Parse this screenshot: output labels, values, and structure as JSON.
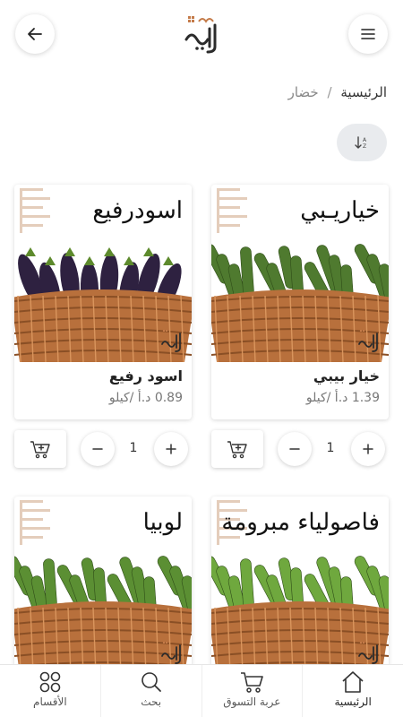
{
  "header": {
    "logo_text": "سلة أبوعلي"
  },
  "breadcrumb": {
    "home": "الرئيسية",
    "separator": "/",
    "current": "خضار"
  },
  "sort": {
    "icon": "sort-az-icon"
  },
  "products": [
    {
      "image_title": "خياريـبي",
      "name": "خيار بيبي",
      "price": "1.39 د.أ /كيلو",
      "quantity": "1",
      "veg_color": "#4f7a2f"
    },
    {
      "image_title": "اسودرفيع",
      "name": "اسود رفيع",
      "price": "0.89 د.أ /كيلو",
      "quantity": "1",
      "veg_color": "#2e2140"
    },
    {
      "image_title": "فاصولياء مبرومة",
      "name": "",
      "price": "",
      "quantity": "",
      "veg_color": "#6fa83e"
    },
    {
      "image_title": "لوبيا",
      "name": "",
      "price": "",
      "quantity": "",
      "veg_color": "#5b8f33"
    }
  ],
  "bottom_nav": [
    {
      "label": "الرئيسية",
      "icon": "home-icon",
      "active": true
    },
    {
      "label": "عربة التسوق",
      "icon": "cart-icon",
      "active": false
    },
    {
      "label": "بحث",
      "icon": "search-icon",
      "active": false
    },
    {
      "label": "الأقسام",
      "icon": "grid-icon",
      "active": false
    }
  ],
  "colors": {
    "basket": "#b8703c",
    "basket_dark": "#8a4f25",
    "pattern": "#e4cdbb",
    "brand_dark": "#2b2b2b",
    "brand_accent": "#c47b49"
  }
}
